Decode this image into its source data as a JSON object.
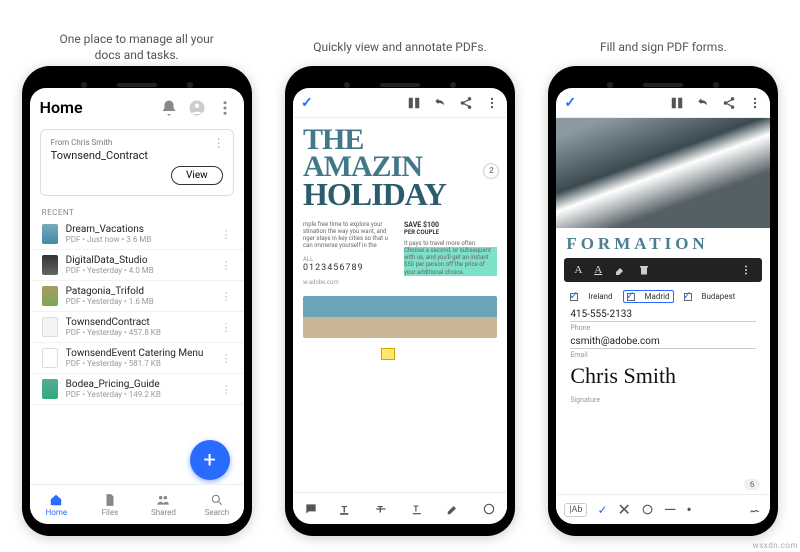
{
  "captions": {
    "c1": "One place to manage all your docs and tasks.",
    "c2": "Quickly view and annotate PDFs.",
    "c3": "Fill and sign PDF forms."
  },
  "phone1": {
    "title": "Home",
    "card": {
      "from": "From Chris Smith",
      "name": "Townsend_Contract",
      "view": "View"
    },
    "section": "RECENT",
    "files": [
      {
        "name": "Dream_Vacations",
        "meta": "PDF  •  Just now  •  3.6 MB"
      },
      {
        "name": "DigitalData_Studio",
        "meta": "PDF  •  Yesterday  •  4.0 MB"
      },
      {
        "name": "Patagonia_Trifold",
        "meta": "PDF  •  Yesterday  •  1.6 MB"
      },
      {
        "name": "TownsendContract",
        "meta": "PDF  •  Yesterday  •  457.8 KB"
      },
      {
        "name": "TownsendEvent Catering Menu",
        "meta": "PDF  •  Yesterday  •  581.7 KB"
      },
      {
        "name": "Bodea_Pricing_Guide",
        "meta": "PDF  •  Yesterday  •  149.2 KB"
      }
    ],
    "tabs": {
      "home": "Home",
      "files": "Files",
      "shared": "Shared",
      "search": "Search"
    }
  },
  "phone2": {
    "headline": {
      "w1": "THE",
      "w2": "AMAZIN",
      "w3": "HOLIDAY",
      "badge": "2"
    },
    "left": {
      "para": "mple free time to explore your stination the way you want, and nger stays in key cities so that u can immerse yourself in the",
      "tel_lbl": "ALL",
      "tel": "0123456789",
      "site": "w.adobe.com"
    },
    "right": {
      "save": "SAVE $100",
      "per": "PER COUPLE",
      "promo1": "It pays to travel more often.",
      "promo2": "Choose a second, or subsequent with us, and you'll get an instant $50 per person off the price of your additional choice."
    }
  },
  "phone3": {
    "formation": "FORMATION",
    "checks": {
      "a": "Ireland",
      "b": "Madrid",
      "c": "Budapest"
    },
    "phone_field": {
      "val": "415-555-2133",
      "lbl": "Phone"
    },
    "email_field": {
      "val": "csmith@adobe.com",
      "lbl": "Email"
    },
    "sig": "Chris Smith",
    "sig_lbl": "Signature",
    "toolbar": {
      "ab": "|Ab"
    },
    "page": "6"
  },
  "watermark": "wsxdn.com"
}
